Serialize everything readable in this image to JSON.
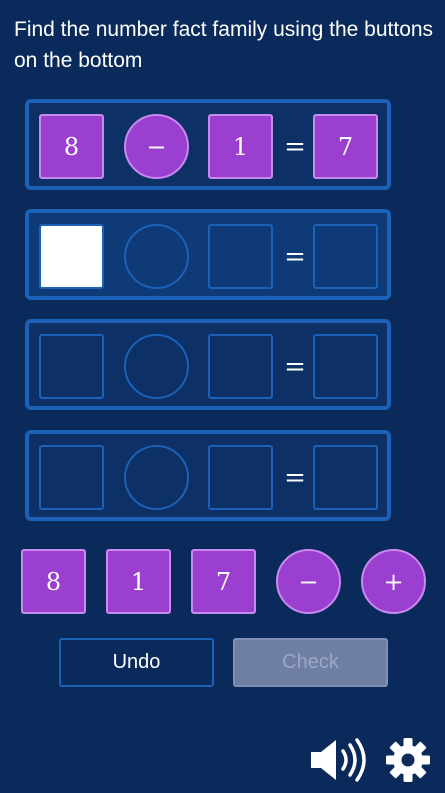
{
  "instructions": "Find the number fact family using the buttons on the bottom",
  "equations": [
    {
      "a": "8",
      "op": "−",
      "b": "1",
      "equals": "=",
      "result": "7"
    },
    {
      "a": "",
      "op": "",
      "b": "",
      "equals": "=",
      "result": ""
    },
    {
      "a": "",
      "op": "",
      "b": "",
      "equals": "=",
      "result": ""
    },
    {
      "a": "",
      "op": "",
      "b": "",
      "equals": "=",
      "result": ""
    }
  ],
  "tiles": [
    {
      "label": "8",
      "kind": "number"
    },
    {
      "label": "1",
      "kind": "number"
    },
    {
      "label": "7",
      "kind": "number"
    },
    {
      "label": "−",
      "kind": "operator"
    },
    {
      "label": "+",
      "kind": "operator"
    }
  ],
  "buttons": {
    "undo_label": "Undo",
    "check_label": "Check",
    "check_enabled": false
  },
  "icons": {
    "sound": "speaker-icon",
    "settings": "gear-icon"
  },
  "colors": {
    "background": "#0b2a5c",
    "tile_fill": "#9b3fd1",
    "slot_border": "#1c61b8",
    "check_disabled": "#6f7fa3"
  }
}
